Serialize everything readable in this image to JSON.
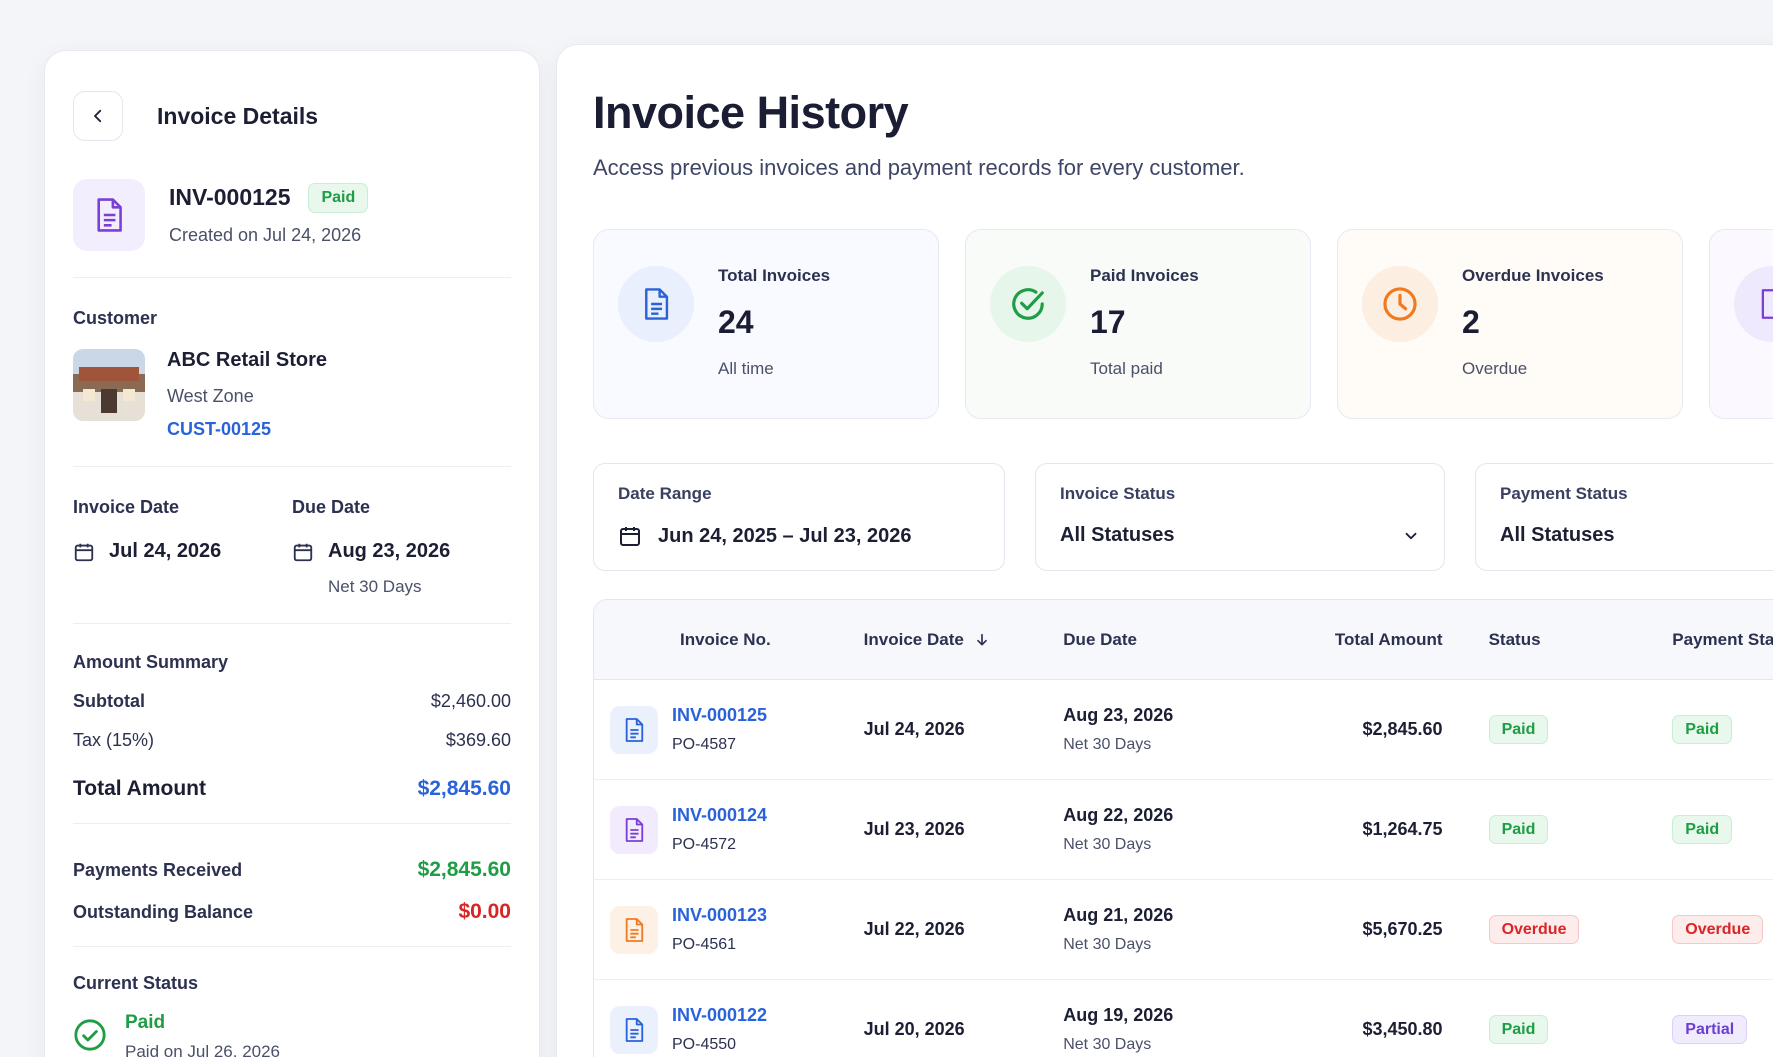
{
  "detail": {
    "title": "Invoice Details",
    "invoice_id": "INV-000125",
    "status_badge": "Paid",
    "created": "Created on Jul 24, 2026",
    "customer_label": "Customer",
    "customer_name": "ABC Retail Store",
    "customer_zone": "West Zone",
    "customer_id": "CUST-00125",
    "invoice_date_label": "Invoice Date",
    "invoice_date": "Jul 24, 2026",
    "due_date_label": "Due Date",
    "due_date": "Aug 23, 2026",
    "due_terms": "Net 30 Days",
    "amount_summary_label": "Amount Summary",
    "subtotal_label": "Subtotal",
    "subtotal": "$2,460.00",
    "tax_label": "Tax (15%)",
    "tax": "$369.60",
    "total_label": "Total Amount",
    "total": "$2,845.60",
    "payments_received_label": "Payments Received",
    "payments_received": "$2,845.60",
    "outstanding_label": "Outstanding Balance",
    "outstanding": "$0.00",
    "current_status_label": "Current Status",
    "current_status": "Paid",
    "current_status_sub": "Paid on Jul 26, 2026"
  },
  "main": {
    "title": "Invoice History",
    "subtitle": "Access previous invoices and payment records for every customer.",
    "stats": [
      {
        "label": "Total Invoices",
        "value": "24",
        "sub": "All time",
        "icon": "document-icon",
        "color": "#2a63d9"
      },
      {
        "label": "Paid Invoices",
        "value": "17",
        "sub": "Total paid",
        "icon": "check-circle-icon",
        "color": "#1f9d45"
      },
      {
        "label": "Overdue Invoices",
        "value": "2",
        "sub": "Overdue",
        "icon": "clock-icon",
        "color": "#f07a1f"
      }
    ],
    "filters": {
      "date_range_label": "Date Range",
      "date_range_value": "Jun 24, 2025 – Jul 23, 2026",
      "invoice_status_label": "Invoice Status",
      "invoice_status_value": "All Statuses",
      "payment_status_label": "Payment Status",
      "payment_status_value": "All Statuses"
    },
    "table": {
      "headers": [
        "Invoice No.",
        "Invoice Date",
        "Due Date",
        "Total Amount",
        "Status",
        "Payment Sta"
      ],
      "rows": [
        {
          "invoice": "INV-000125",
          "po": "PO-4587",
          "date": "Jul 24, 2026",
          "due": "Aug 23, 2026",
          "terms": "Net 30 Days",
          "amount": "$2,845.60",
          "status": "Paid",
          "payment": "Paid",
          "icon_color": "#2a63d9"
        },
        {
          "invoice": "INV-000124",
          "po": "PO-4572",
          "date": "Jul 23, 2026",
          "due": "Aug 22, 2026",
          "terms": "Net 30 Days",
          "amount": "$1,264.75",
          "status": "Paid",
          "payment": "Paid",
          "icon_color": "#7b3fd6"
        },
        {
          "invoice": "INV-000123",
          "po": "PO-4561",
          "date": "Jul 22, 2026",
          "due": "Aug 21, 2026",
          "terms": "Net 30 Days",
          "amount": "$5,670.25",
          "status": "Overdue",
          "payment": "Overdue",
          "icon_color": "#f07a1f"
        },
        {
          "invoice": "INV-000122",
          "po": "PO-4550",
          "date": "Jul 20, 2026",
          "due": "Aug 19, 2026",
          "terms": "Net 30 Days",
          "amount": "$3,450.80",
          "status": "Paid",
          "payment": "Partial",
          "icon_color": "#2a63d9"
        }
      ]
    }
  }
}
